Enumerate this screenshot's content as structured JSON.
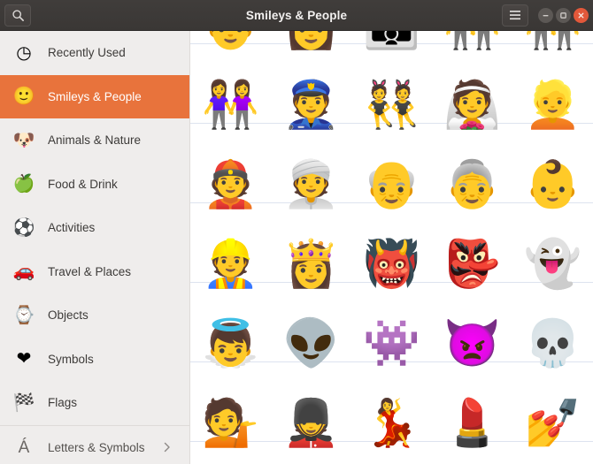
{
  "titlebar": {
    "title": "Smileys & People",
    "search_icon": "search-icon",
    "menu_icon": "hamburger-menu-icon",
    "minimize_icon": "minimize-icon",
    "maximize_icon": "maximize-icon",
    "close_icon": "close-icon"
  },
  "sidebar": {
    "items": [
      {
        "label": "Recently Used",
        "icon": "clock-icon",
        "glyph": "◷",
        "selected": false
      },
      {
        "label": "Smileys & People",
        "icon": "smiley-icon",
        "glyph": "🙂",
        "selected": true
      },
      {
        "label": "Animals & Nature",
        "icon": "dog-face-icon",
        "glyph": "🐶",
        "selected": false
      },
      {
        "label": "Food & Drink",
        "icon": "green-apple-icon",
        "glyph": "🍏",
        "selected": false
      },
      {
        "label": "Activities",
        "icon": "soccer-ball-icon",
        "glyph": "⚽",
        "selected": false
      },
      {
        "label": "Travel & Places",
        "icon": "car-icon",
        "glyph": "🚗",
        "selected": false
      },
      {
        "label": "Objects",
        "icon": "watch-icon",
        "glyph": "⌚",
        "selected": false
      },
      {
        "label": "Symbols",
        "icon": "heart-icon",
        "glyph": "❤",
        "selected": false
      },
      {
        "label": "Flags",
        "icon": "checkered-flag-icon",
        "glyph": "🏁",
        "selected": false
      }
    ],
    "footer": {
      "label": "Letters & Symbols",
      "icon": "accented-a-icon",
      "glyph": "Á",
      "chevron": "chevron-right-icon"
    }
  },
  "grid": {
    "columns": 5,
    "rows": [
      {
        "name": "row-families-partial",
        "cells": [
          {
            "name": "man",
            "glyph": "👨"
          },
          {
            "name": "woman",
            "glyph": "👩"
          },
          {
            "name": "family",
            "glyph": "👪"
          },
          {
            "name": "two-men-holding-hands",
            "glyph": "👬"
          },
          {
            "name": "two-women-holding-hands",
            "glyph": "👭"
          }
        ]
      },
      {
        "name": "row-couple-police-bunny-bride-blond",
        "cells": [
          {
            "name": "woman-and-woman-holding-hands",
            "glyph": "👭"
          },
          {
            "name": "police-officer",
            "glyph": "👮"
          },
          {
            "name": "people-with-bunny-ears",
            "glyph": "👯"
          },
          {
            "name": "bride-with-veil",
            "glyph": "👰"
          },
          {
            "name": "blond-haired-person",
            "glyph": "👱"
          }
        ]
      },
      {
        "name": "row-gua-pi-mao-turban-older-baby",
        "cells": [
          {
            "name": "man-with-chinese-cap",
            "glyph": "👲"
          },
          {
            "name": "person-wearing-turban",
            "glyph": "👳"
          },
          {
            "name": "older-man",
            "glyph": "👴"
          },
          {
            "name": "older-woman",
            "glyph": "👵"
          },
          {
            "name": "baby",
            "glyph": "👶"
          }
        ]
      },
      {
        "name": "row-worker-princess-ogre-goblin-ghost",
        "cells": [
          {
            "name": "construction-worker",
            "glyph": "👷"
          },
          {
            "name": "princess",
            "glyph": "👸"
          },
          {
            "name": "ogre",
            "glyph": "👹"
          },
          {
            "name": "goblin",
            "glyph": "👺"
          },
          {
            "name": "ghost",
            "glyph": "👻"
          }
        ]
      },
      {
        "name": "row-angel-alien-monster-devil-skull",
        "cells": [
          {
            "name": "baby-angel",
            "glyph": "👼"
          },
          {
            "name": "alien",
            "glyph": "👽"
          },
          {
            "name": "alien-monster",
            "glyph": "👾"
          },
          {
            "name": "angry-face-with-horns",
            "glyph": "👿"
          },
          {
            "name": "skull",
            "glyph": "💀"
          }
        ]
      },
      {
        "name": "row-infodesk-guard-dancer-lipstick-nailpolish",
        "cells": [
          {
            "name": "information-desk-person",
            "glyph": "💁"
          },
          {
            "name": "guard",
            "glyph": "💂"
          },
          {
            "name": "woman-dancing",
            "glyph": "💃"
          },
          {
            "name": "lipstick",
            "glyph": "💄"
          },
          {
            "name": "nail-polish",
            "glyph": "💅"
          }
        ]
      }
    ]
  },
  "colors": {
    "titlebar": "#3d3a38",
    "selected_accent": "#e8733c",
    "sidebar_bg": "#efedec",
    "grid_bg": "#ffffff",
    "row_separator": "#dde3ef",
    "close_button": "#e2583a"
  }
}
